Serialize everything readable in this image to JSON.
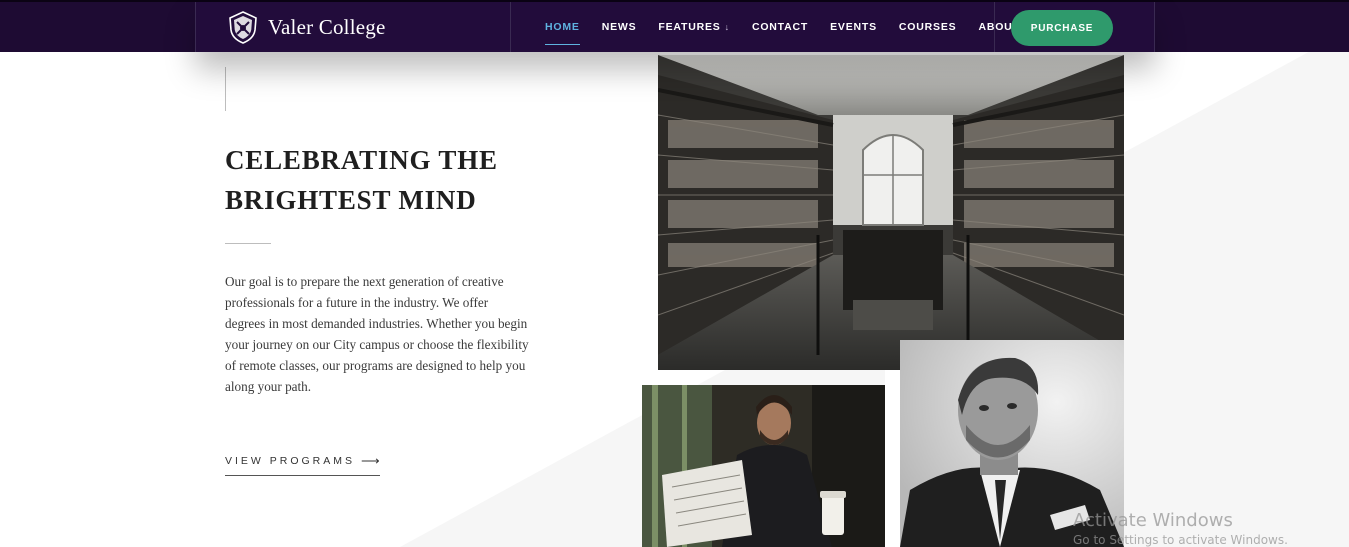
{
  "nav": {
    "logo_text": "Valer College",
    "items": [
      {
        "label": "HOME",
        "active": true
      },
      {
        "label": "NEWS",
        "active": false
      },
      {
        "label": "FEATURES",
        "active": false,
        "dropdown": true
      },
      {
        "label": "CONTACT",
        "active": false
      },
      {
        "label": "EVENTS",
        "active": false
      },
      {
        "label": "COURSES",
        "active": false
      },
      {
        "label": "ABOUT",
        "active": false
      }
    ],
    "purchase_label": "PURCHASE",
    "colors": {
      "bar": "#220c3b",
      "active": "#5fb3e0",
      "purchase": "#2f9a6c"
    }
  },
  "hero": {
    "title": "CELEBRATING THE BRIGHTEST MIND",
    "body": "Our goal is to prepare the next generation of creative professionals for a future in the industry. We offer degrees in most demanded industries. Whether you begin your journey on our City campus or choose the flexibility of remote classes, our programs are designed to help you along your path.",
    "cta_label": "VIEW PROGRAMS",
    "cta_icon": "arrow-right-icon"
  },
  "images": {
    "library": "library-photo",
    "reader": "man-reading-newspaper-photo",
    "portrait": "man-portrait-photo"
  },
  "watermark": {
    "title": "Activate Windows",
    "subtitle": "Go to Settings to activate Windows."
  }
}
